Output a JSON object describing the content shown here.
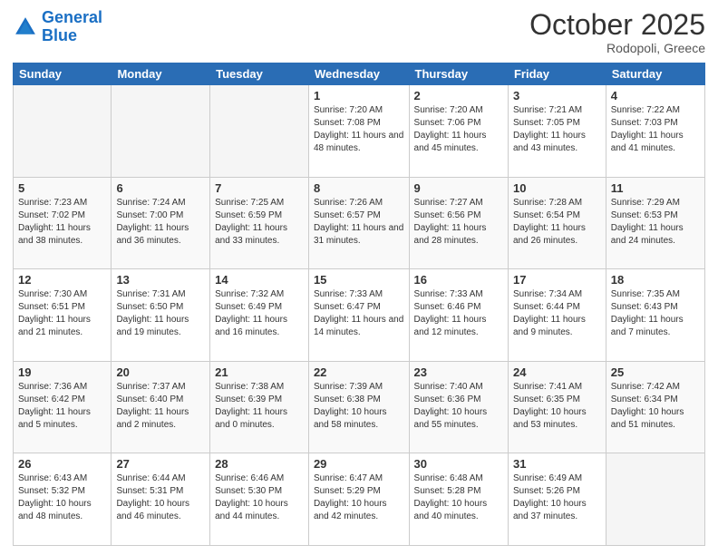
{
  "logo": {
    "line1": "General",
    "line2": "Blue"
  },
  "header": {
    "month_year": "October 2025",
    "location": "Rodopoli, Greece"
  },
  "weekdays": [
    "Sunday",
    "Monday",
    "Tuesday",
    "Wednesday",
    "Thursday",
    "Friday",
    "Saturday"
  ],
  "weeks": [
    [
      {
        "day": "",
        "sunrise": "",
        "sunset": "",
        "daylight": "",
        "empty": true
      },
      {
        "day": "",
        "sunrise": "",
        "sunset": "",
        "daylight": "",
        "empty": true
      },
      {
        "day": "",
        "sunrise": "",
        "sunset": "",
        "daylight": "",
        "empty": true
      },
      {
        "day": "1",
        "sunrise": "Sunrise: 7:20 AM",
        "sunset": "Sunset: 7:08 PM",
        "daylight": "Daylight: 11 hours and 48 minutes."
      },
      {
        "day": "2",
        "sunrise": "Sunrise: 7:20 AM",
        "sunset": "Sunset: 7:06 PM",
        "daylight": "Daylight: 11 hours and 45 minutes."
      },
      {
        "day": "3",
        "sunrise": "Sunrise: 7:21 AM",
        "sunset": "Sunset: 7:05 PM",
        "daylight": "Daylight: 11 hours and 43 minutes."
      },
      {
        "day": "4",
        "sunrise": "Sunrise: 7:22 AM",
        "sunset": "Sunset: 7:03 PM",
        "daylight": "Daylight: 11 hours and 41 minutes."
      }
    ],
    [
      {
        "day": "5",
        "sunrise": "Sunrise: 7:23 AM",
        "sunset": "Sunset: 7:02 PM",
        "daylight": "Daylight: 11 hours and 38 minutes."
      },
      {
        "day": "6",
        "sunrise": "Sunrise: 7:24 AM",
        "sunset": "Sunset: 7:00 PM",
        "daylight": "Daylight: 11 hours and 36 minutes."
      },
      {
        "day": "7",
        "sunrise": "Sunrise: 7:25 AM",
        "sunset": "Sunset: 6:59 PM",
        "daylight": "Daylight: 11 hours and 33 minutes."
      },
      {
        "day": "8",
        "sunrise": "Sunrise: 7:26 AM",
        "sunset": "Sunset: 6:57 PM",
        "daylight": "Daylight: 11 hours and 31 minutes."
      },
      {
        "day": "9",
        "sunrise": "Sunrise: 7:27 AM",
        "sunset": "Sunset: 6:56 PM",
        "daylight": "Daylight: 11 hours and 28 minutes."
      },
      {
        "day": "10",
        "sunrise": "Sunrise: 7:28 AM",
        "sunset": "Sunset: 6:54 PM",
        "daylight": "Daylight: 11 hours and 26 minutes."
      },
      {
        "day": "11",
        "sunrise": "Sunrise: 7:29 AM",
        "sunset": "Sunset: 6:53 PM",
        "daylight": "Daylight: 11 hours and 24 minutes."
      }
    ],
    [
      {
        "day": "12",
        "sunrise": "Sunrise: 7:30 AM",
        "sunset": "Sunset: 6:51 PM",
        "daylight": "Daylight: 11 hours and 21 minutes."
      },
      {
        "day": "13",
        "sunrise": "Sunrise: 7:31 AM",
        "sunset": "Sunset: 6:50 PM",
        "daylight": "Daylight: 11 hours and 19 minutes."
      },
      {
        "day": "14",
        "sunrise": "Sunrise: 7:32 AM",
        "sunset": "Sunset: 6:49 PM",
        "daylight": "Daylight: 11 hours and 16 minutes."
      },
      {
        "day": "15",
        "sunrise": "Sunrise: 7:33 AM",
        "sunset": "Sunset: 6:47 PM",
        "daylight": "Daylight: 11 hours and 14 minutes."
      },
      {
        "day": "16",
        "sunrise": "Sunrise: 7:33 AM",
        "sunset": "Sunset: 6:46 PM",
        "daylight": "Daylight: 11 hours and 12 minutes."
      },
      {
        "day": "17",
        "sunrise": "Sunrise: 7:34 AM",
        "sunset": "Sunset: 6:44 PM",
        "daylight": "Daylight: 11 hours and 9 minutes."
      },
      {
        "day": "18",
        "sunrise": "Sunrise: 7:35 AM",
        "sunset": "Sunset: 6:43 PM",
        "daylight": "Daylight: 11 hours and 7 minutes."
      }
    ],
    [
      {
        "day": "19",
        "sunrise": "Sunrise: 7:36 AM",
        "sunset": "Sunset: 6:42 PM",
        "daylight": "Daylight: 11 hours and 5 minutes."
      },
      {
        "day": "20",
        "sunrise": "Sunrise: 7:37 AM",
        "sunset": "Sunset: 6:40 PM",
        "daylight": "Daylight: 11 hours and 2 minutes."
      },
      {
        "day": "21",
        "sunrise": "Sunrise: 7:38 AM",
        "sunset": "Sunset: 6:39 PM",
        "daylight": "Daylight: 11 hours and 0 minutes."
      },
      {
        "day": "22",
        "sunrise": "Sunrise: 7:39 AM",
        "sunset": "Sunset: 6:38 PM",
        "daylight": "Daylight: 10 hours and 58 minutes."
      },
      {
        "day": "23",
        "sunrise": "Sunrise: 7:40 AM",
        "sunset": "Sunset: 6:36 PM",
        "daylight": "Daylight: 10 hours and 55 minutes."
      },
      {
        "day": "24",
        "sunrise": "Sunrise: 7:41 AM",
        "sunset": "Sunset: 6:35 PM",
        "daylight": "Daylight: 10 hours and 53 minutes."
      },
      {
        "day": "25",
        "sunrise": "Sunrise: 7:42 AM",
        "sunset": "Sunset: 6:34 PM",
        "daylight": "Daylight: 10 hours and 51 minutes."
      }
    ],
    [
      {
        "day": "26",
        "sunrise": "Sunrise: 6:43 AM",
        "sunset": "Sunset: 5:32 PM",
        "daylight": "Daylight: 10 hours and 48 minutes."
      },
      {
        "day": "27",
        "sunrise": "Sunrise: 6:44 AM",
        "sunset": "Sunset: 5:31 PM",
        "daylight": "Daylight: 10 hours and 46 minutes."
      },
      {
        "day": "28",
        "sunrise": "Sunrise: 6:46 AM",
        "sunset": "Sunset: 5:30 PM",
        "daylight": "Daylight: 10 hours and 44 minutes."
      },
      {
        "day": "29",
        "sunrise": "Sunrise: 6:47 AM",
        "sunset": "Sunset: 5:29 PM",
        "daylight": "Daylight: 10 hours and 42 minutes."
      },
      {
        "day": "30",
        "sunrise": "Sunrise: 6:48 AM",
        "sunset": "Sunset: 5:28 PM",
        "daylight": "Daylight: 10 hours and 40 minutes."
      },
      {
        "day": "31",
        "sunrise": "Sunrise: 6:49 AM",
        "sunset": "Sunset: 5:26 PM",
        "daylight": "Daylight: 10 hours and 37 minutes."
      },
      {
        "day": "",
        "sunrise": "",
        "sunset": "",
        "daylight": "",
        "empty": true
      }
    ]
  ]
}
